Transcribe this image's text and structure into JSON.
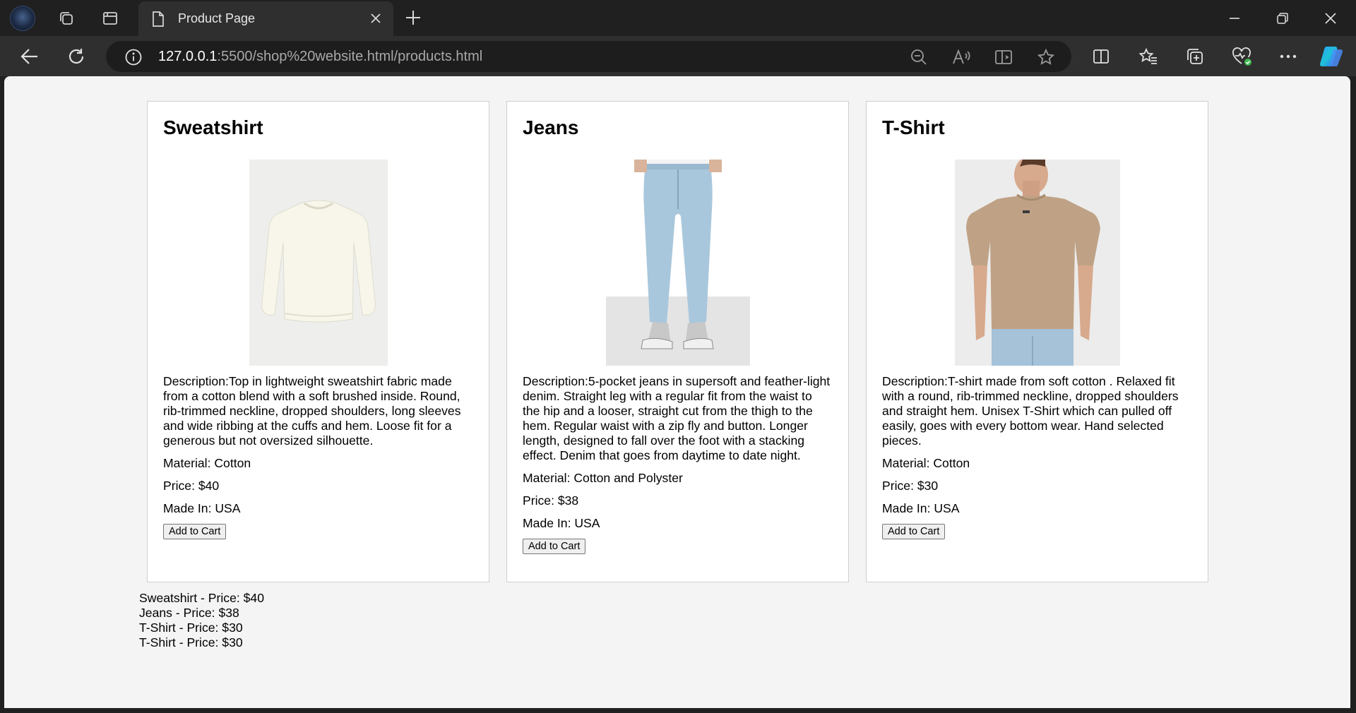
{
  "browser": {
    "tab_title": "Product Page",
    "url_host": "127.0.0.1",
    "url_rest": ":5500/shop%20website.html/products.html"
  },
  "products": [
    {
      "name": "Sweatshirt",
      "image": "sweatshirt-image",
      "description": "Description:Top in lightweight sweatshirt fabric made from a cotton blend with a soft brushed inside. Round, rib-trimmed neckline, dropped shoulders, long sleeves and wide ribbing at the cuffs and hem. Loose fit for a generous but not oversized silhouette.",
      "material": "Material: Cotton",
      "price": "Price: $40",
      "made_in": "Made In: USA",
      "button": "Add to Cart"
    },
    {
      "name": "Jeans",
      "image": "jeans-image",
      "description": "Description:5-pocket jeans in supersoft and feather-light denim. Straight leg with a regular fit from the waist to the hip and a looser, straight cut from the thigh to the hem. Regular waist with a zip fly and button. Longer length, designed to fall over the foot with a stacking effect. Denim that goes from daytime to date night.",
      "material": "Material: Cotton and Polyster",
      "price": "Price: $38",
      "made_in": "Made In: USA",
      "button": "Add to Cart"
    },
    {
      "name": "T-Shirt",
      "image": "tshirt-image",
      "description": "Description:T-shirt made from soft cotton . Relaxed fit with a round, rib-trimmed neckline, dropped shoulders and straight hem. Unisex T-Shirt which can pulled off easily, goes with every bottom wear. Hand selected pieces.",
      "material": "Material: Cotton",
      "price": "Price: $30",
      "made_in": "Made In: USA",
      "button": "Add to Cart"
    }
  ],
  "cart": [
    "Sweatshirt - Price: $40",
    "Jeans - Price: $38",
    "T-Shirt - Price: $30",
    "T-Shirt - Price: $30"
  ],
  "colors": {
    "browser_chrome": "#202020",
    "toolbar": "#2f2f2f",
    "page_bg": "#f4f4f4",
    "card_bg": "#ffffff"
  }
}
